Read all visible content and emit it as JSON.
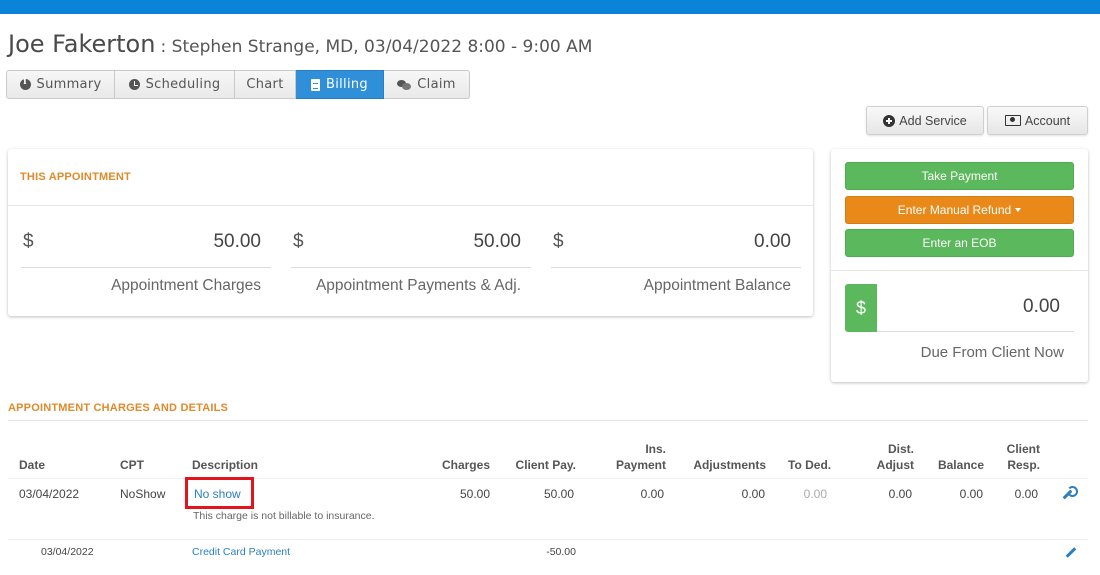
{
  "header": {
    "patient_name": "Joe Fakerton",
    "appointment_info": ": Stephen Strange, MD, 03/04/2022 8:00 - 9:00 AM"
  },
  "tabs": [
    {
      "label": "Summary",
      "icon": "info-icon"
    },
    {
      "label": "Scheduling",
      "icon": "clock-icon"
    },
    {
      "label": "Chart",
      "icon": ""
    },
    {
      "label": "Billing",
      "icon": "document-icon",
      "active": true
    },
    {
      "label": "Claim",
      "icon": "chat-icon"
    }
  ],
  "actions": {
    "add_service": "Add Service",
    "account": "Account"
  },
  "this_appointment": {
    "title": "THIS APPOINTMENT",
    "currency": "$",
    "charges": {
      "amount": "50.00",
      "label": "Appointment Charges"
    },
    "payments": {
      "amount": "50.00",
      "label": "Appointment Payments & Adj."
    },
    "balance": {
      "amount": "0.00",
      "label": "Appointment Balance"
    }
  },
  "payment_panel": {
    "take_payment": "Take Payment",
    "manual_refund": "Enter Manual Refund",
    "enter_eob": "Enter an EOB",
    "currency": "$",
    "due_amount": "0.00",
    "due_label": "Due From Client Now"
  },
  "details": {
    "title": "APPOINTMENT CHARGES AND DETAILS",
    "columns": {
      "date": "Date",
      "cpt": "CPT",
      "description": "Description",
      "charges": "Charges",
      "client_pay": "Client Pay.",
      "ins_payment_1": "Ins.",
      "ins_payment_2": "Payment",
      "adjustments": "Adjustments",
      "to_ded": "To Ded.",
      "dist_adjust_1": "Dist.",
      "dist_adjust_2": "Adjust",
      "balance": "Balance",
      "client_resp_1": "Client",
      "client_resp_2": "Resp."
    },
    "rows": [
      {
        "date": "03/04/2022",
        "cpt": "NoShow",
        "description": "No show",
        "note": "This charge is not billable to insurance.",
        "charges": "50.00",
        "client_pay": "50.00",
        "ins_payment": "0.00",
        "adjustments": "0.00",
        "to_ded": "0.00",
        "dist_adjust": "0.00",
        "balance": "0.00",
        "client_resp": "0.00"
      },
      {
        "date": "03/04/2022",
        "description": "Credit Card Payment",
        "client_pay": "-50.00"
      }
    ]
  },
  "colors": {
    "top_bar": "#0a84d8",
    "active_tab": "#2f8fd8",
    "section_header": "#e08a2a",
    "green_button": "#5cb85c",
    "orange_button": "#e8891a",
    "link": "#2a7fc4",
    "highlight_box": "#e2141c"
  }
}
